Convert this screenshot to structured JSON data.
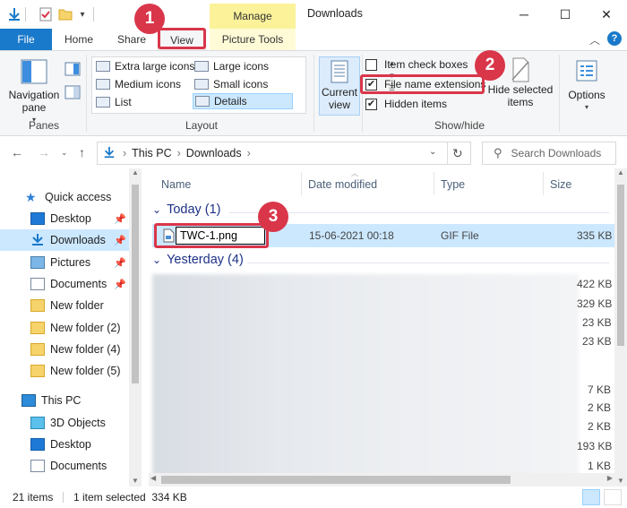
{
  "title": "Downloads",
  "context_tab": "Manage",
  "tabs": {
    "file": "File",
    "home": "Home",
    "share": "Share",
    "view": "View",
    "picture_tools": "Picture Tools"
  },
  "window_controls": {
    "minimize": "─",
    "maximize": "☐",
    "close": "✕"
  },
  "ribbon": {
    "panes": {
      "nav_pane_label_1": "Navigation",
      "nav_pane_label_2": "pane",
      "group_label": "Panes"
    },
    "layout": {
      "group_label": "Layout",
      "options": {
        "extra_large": "Extra large icons",
        "large": "Large icons",
        "medium": "Medium icons",
        "small": "Small icons",
        "list": "List",
        "details": "Details"
      }
    },
    "current_view": {
      "label_1": "Current",
      "label_2": "view"
    },
    "show_hide": {
      "group_label": "Show/hide",
      "item_check_boxes": "Item check boxes",
      "file_name_extensions": "File name extensions",
      "hidden_items": "Hidden items",
      "hidden_selected_1": "Hide selected",
      "hidden_selected_2": "items"
    },
    "options": {
      "label": "Options"
    }
  },
  "address": {
    "segments": [
      "This PC",
      "Downloads"
    ],
    "search_placeholder": "Search Downloads"
  },
  "nav_pane": {
    "items": [
      {
        "label": "Quick access"
      },
      {
        "label": "Desktop"
      },
      {
        "label": "Downloads"
      },
      {
        "label": "Pictures"
      },
      {
        "label": "Documents"
      },
      {
        "label": "New folder"
      },
      {
        "label": "New folder (2)"
      },
      {
        "label": "New folder (4)"
      },
      {
        "label": "New folder (5)"
      },
      {
        "label": "This PC"
      },
      {
        "label": "3D Objects"
      },
      {
        "label": "Desktop"
      },
      {
        "label": "Documents"
      }
    ]
  },
  "columns": [
    "Name",
    "Date modified",
    "Type",
    "Size"
  ],
  "groups": {
    "today": "Today (1)",
    "yesterday": "Yesterday (4)"
  },
  "selected_file": {
    "name": "TWC-1.png",
    "date": "15-06-2021 00:18",
    "type": "GIF File",
    "size": "335 KB"
  },
  "other_sizes": [
    "422 KB",
    "329 KB",
    "23 KB",
    "23 KB",
    "7 KB",
    "2 KB",
    "2 KB",
    "193 KB",
    "1 KB"
  ],
  "status": {
    "count": "21 items",
    "selection": "1 item selected  334 KB"
  },
  "callouts": [
    "1",
    "2",
    "3"
  ]
}
